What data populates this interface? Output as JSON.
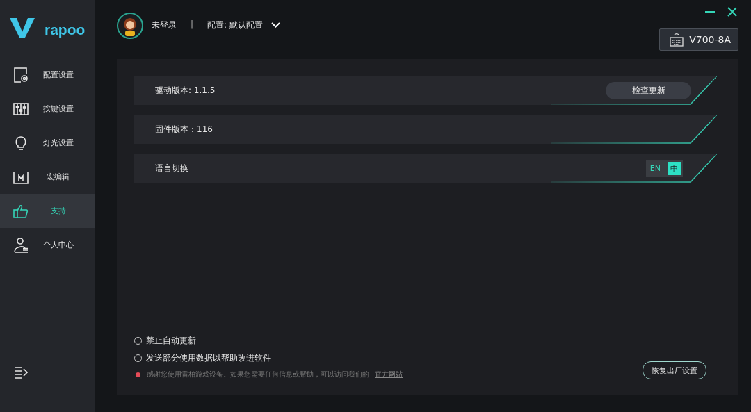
{
  "logo": {
    "text": "rapoo"
  },
  "sidebar": {
    "items": [
      {
        "label": "配置设置",
        "selected": false
      },
      {
        "label": "按键设置",
        "selected": false
      },
      {
        "label": "灯光设置",
        "selected": false
      },
      {
        "label": "宏编辑",
        "selected": false
      },
      {
        "label": "支持",
        "selected": true
      },
      {
        "label": "个人中心",
        "selected": false
      }
    ]
  },
  "header": {
    "user": "未登录",
    "separator": "|",
    "profile": "配置: 默认配置",
    "device": "V700-8A"
  },
  "rows": [
    {
      "kind": "button",
      "label": "驱动版本: 1.1.5",
      "button": "检查更新"
    },
    {
      "kind": "info",
      "label": "固件版本：116"
    },
    {
      "kind": "toggle",
      "label": "语言切换",
      "options": [
        {
          "label": "EN",
          "selected": false
        },
        {
          "label": "中",
          "selected": true
        }
      ]
    }
  ],
  "options": [
    {
      "label": "禁止自动更新",
      "checked": false
    },
    {
      "label": "发送部分使用数据以帮助改进软件",
      "checked": false
    }
  ],
  "notice": {
    "text": "感谢您使用雷柏游戏设备。如果您需要任何信息或帮助，可以访问我们的",
    "link": "官方网站"
  },
  "reset_button": "恢复出厂设置"
}
